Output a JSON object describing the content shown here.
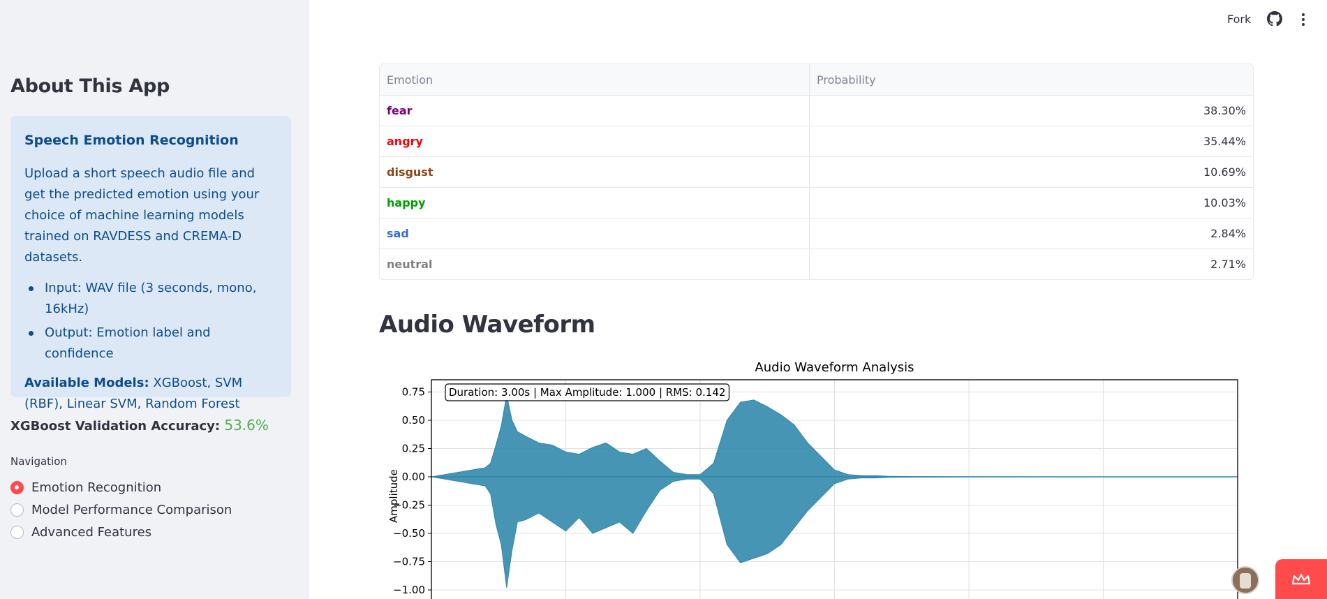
{
  "sidebar": {
    "title": "About This App",
    "info": {
      "heading": "Speech Emotion Recognition",
      "description": "Upload a short speech audio file and get the predicted emotion using your choice of machine learning models trained on RAVDESS and CREMA-D datasets.",
      "bullets": [
        "Input: WAV file (3 seconds, mono, 16kHz)",
        "Output: Emotion label and confidence"
      ],
      "models_label": "Available Models:",
      "models_value": " XGBoost, SVM (RBF), Linear SVM, Random Forest"
    },
    "accuracy_label": "XGBoost Validation Accuracy: ",
    "accuracy_value": "53.6%",
    "accuracy_color": "#4caf50",
    "nav_label": "Navigation",
    "nav_options": [
      {
        "label": "Emotion Recognition",
        "selected": true
      },
      {
        "label": "Model Performance Comparison",
        "selected": false
      },
      {
        "label": "Advanced Features",
        "selected": false
      }
    ]
  },
  "header": {
    "fork_label": "Fork",
    "github_icon": "github-icon",
    "menu_icon": "kebab-menu-icon"
  },
  "table": {
    "headers": [
      "Emotion",
      "Probability"
    ],
    "rows": [
      {
        "emotion": "fear",
        "probability": "38.30%",
        "color": "#800080"
      },
      {
        "emotion": "angry",
        "probability": "35.44%",
        "color": "#ff0000"
      },
      {
        "emotion": "disgust",
        "probability": "10.69%",
        "color": "#8b4513"
      },
      {
        "emotion": "happy",
        "probability": "10.03%",
        "color": "#00a000"
      },
      {
        "emotion": "sad",
        "probability": "2.84%",
        "color": "#3a6bd4"
      },
      {
        "emotion": "neutral",
        "probability": "2.71%",
        "color": "#808080"
      }
    ]
  },
  "section_title": "Audio Waveform",
  "chart_data": {
    "type": "line",
    "title": "Audio Waveform Analysis",
    "annotation": "Duration: 3.00s | Max Amplitude: 1.000 | RMS: 0.142",
    "ylabel": "Amplitude",
    "xlabel": "",
    "ylim": [
      -1.0,
      0.75
    ],
    "xlim": [
      0,
      3.0
    ],
    "yticks": [
      "0.75",
      "0.50",
      "0.25",
      "0.00",
      "−0.25",
      "−0.50",
      "−0.75",
      "−1.00"
    ],
    "ytick_values": [
      0.75,
      0.5,
      0.25,
      0.0,
      -0.25,
      -0.5,
      -0.75,
      -1.0
    ],
    "grid": true,
    "series_color": "#2e86ab",
    "envelope": {
      "x": [
        0.0,
        0.1,
        0.2,
        0.22,
        0.24,
        0.26,
        0.28,
        0.3,
        0.32,
        0.35,
        0.4,
        0.45,
        0.5,
        0.55,
        0.6,
        0.65,
        0.7,
        0.75,
        0.8,
        0.85,
        0.9,
        0.95,
        1.0,
        1.05,
        1.1,
        1.15,
        1.2,
        1.25,
        1.3,
        1.35,
        1.4,
        1.45,
        1.5,
        1.55,
        1.6,
        1.65,
        1.7,
        1.8,
        2.0,
        2.5,
        3.0
      ],
      "upper": [
        0.0,
        0.04,
        0.08,
        0.12,
        0.28,
        0.45,
        0.72,
        0.5,
        0.4,
        0.36,
        0.3,
        0.28,
        0.22,
        0.2,
        0.26,
        0.3,
        0.22,
        0.2,
        0.25,
        0.14,
        0.04,
        0.02,
        0.02,
        0.12,
        0.5,
        0.66,
        0.68,
        0.62,
        0.55,
        0.46,
        0.3,
        0.18,
        0.06,
        0.02,
        0.01,
        0.01,
        0.005,
        0.002,
        0.001,
        0.0,
        0.0
      ],
      "lower": [
        0.0,
        -0.04,
        -0.08,
        -0.15,
        -0.42,
        -0.6,
        -0.98,
        -0.65,
        -0.4,
        -0.38,
        -0.32,
        -0.4,
        -0.48,
        -0.36,
        -0.5,
        -0.45,
        -0.4,
        -0.5,
        -0.3,
        -0.12,
        -0.04,
        -0.02,
        -0.02,
        -0.15,
        -0.6,
        -0.76,
        -0.72,
        -0.68,
        -0.6,
        -0.45,
        -0.3,
        -0.18,
        -0.06,
        -0.02,
        -0.01,
        -0.01,
        -0.005,
        -0.002,
        -0.001,
        0.0,
        0.0
      ]
    }
  }
}
